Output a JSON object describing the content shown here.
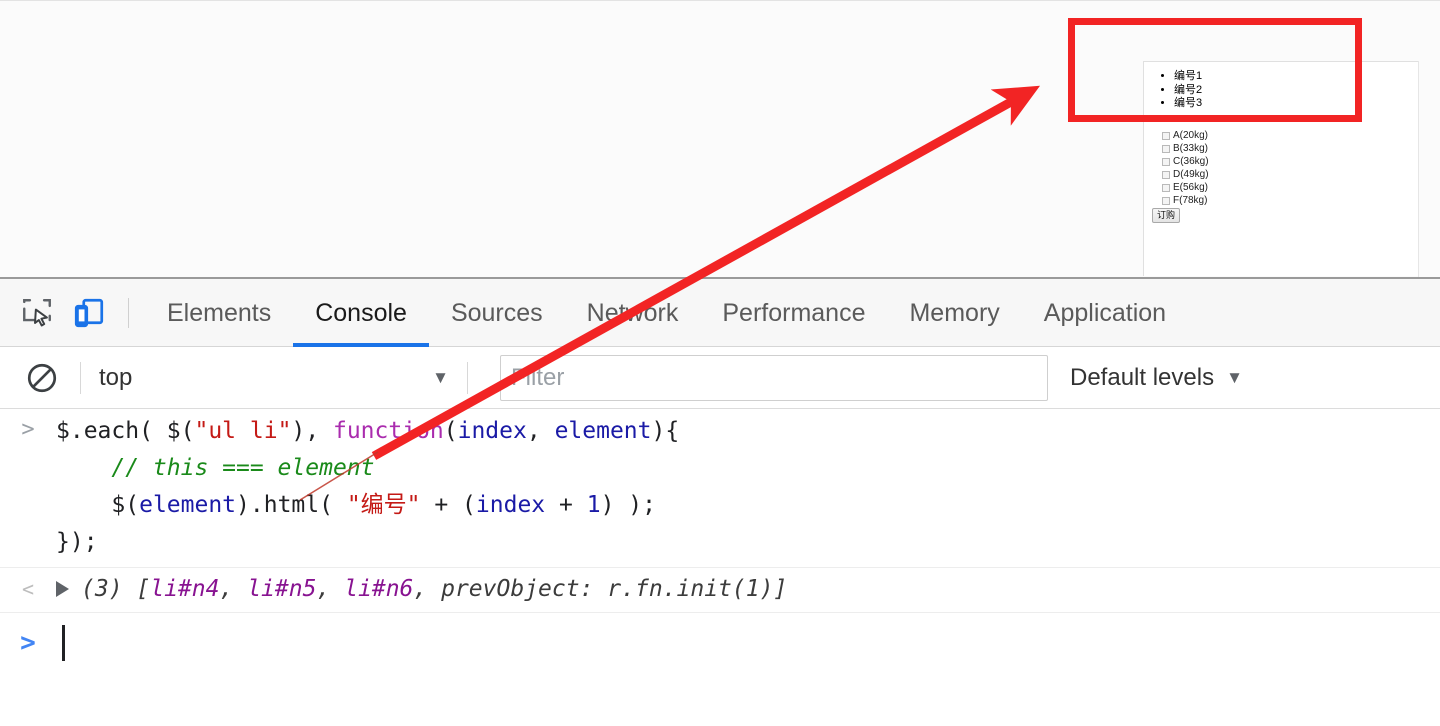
{
  "page": {
    "list_items": [
      "编号1",
      "编号2",
      "编号3"
    ],
    "checkboxes": [
      "A(20kg)",
      "B(33kg)",
      "C(36kg)",
      "D(49kg)",
      "E(56kg)",
      "F(78kg)"
    ],
    "order_button": "订购"
  },
  "annotation": {
    "highlight_color": "#f22424",
    "arrow_color": "#f22424"
  },
  "devtools": {
    "icons": {
      "inspect": "inspect-element-icon",
      "device": "device-toolbar-icon",
      "clear": "clear-console-icon"
    },
    "tabs": [
      {
        "label": "Elements",
        "active": false
      },
      {
        "label": "Console",
        "active": true
      },
      {
        "label": "Sources",
        "active": false
      },
      {
        "label": "Network",
        "active": false
      },
      {
        "label": "Performance",
        "active": false
      },
      {
        "label": "Memory",
        "active": false
      },
      {
        "label": "Application",
        "active": false
      }
    ],
    "active_tab_underline_color": "#1a73e8",
    "filter_bar": {
      "context": "top",
      "context_caret": "▼",
      "filter_placeholder": "Filter",
      "filter_value": "",
      "levels": "Default levels",
      "levels_caret": "▼"
    },
    "console": {
      "input_prompt": ">",
      "output_prompt": "<",
      "expand_triangle": "▶",
      "code": {
        "line1_a": "$.each( $(",
        "line1_str": "\"ul li\"",
        "line1_b": "), ",
        "line1_kw": "function",
        "line1_c": "(",
        "line1_var1": "index",
        "line1_d": ", ",
        "line1_var2": "element",
        "line1_e": "){",
        "line2_comment": "    // this === element",
        "line3_a": "    $(",
        "line3_var": "element",
        "line3_b": ").html( ",
        "line3_str": "\"编号\"",
        "line3_c": " + (",
        "line3_var2": "index",
        "line3_d": " + ",
        "line3_num": "1",
        "line3_e": ") );",
        "line4": "});"
      },
      "output": {
        "count": "(3)",
        "open_bracket": " [",
        "item1": "li#n4",
        "sep1": ", ",
        "item2": "li#n5",
        "sep2": ", ",
        "item3": "li#n6",
        "sep3": ", ",
        "prev": "prevObject: r.fn.init(1)",
        "close_bracket": "]"
      }
    }
  }
}
